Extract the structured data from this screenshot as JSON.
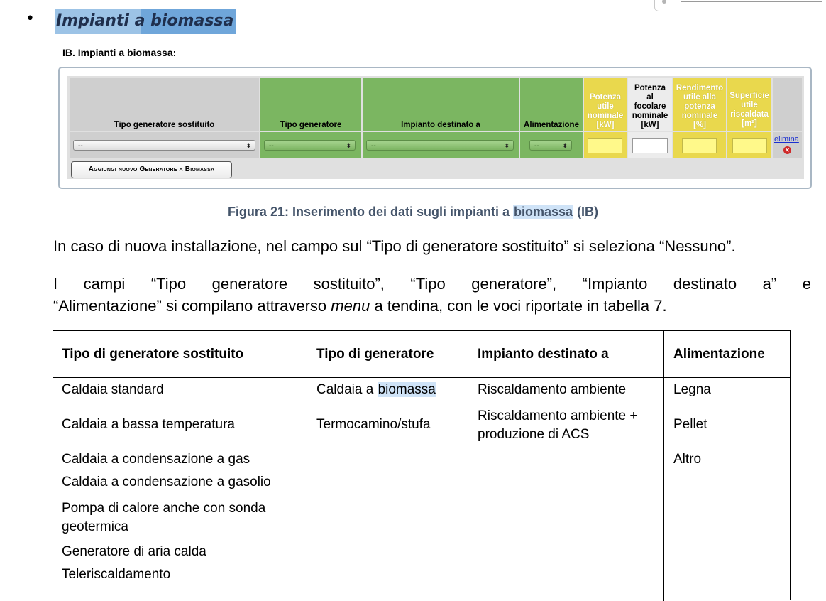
{
  "heading": {
    "bullet": "•",
    "title_part1": "Impianti a ",
    "title_part2": "biomassa"
  },
  "section_title": "IB. Impianti a biomassa:",
  "form": {
    "headers": {
      "tipo_sostituito": "Tipo generatore sostituito",
      "tipo_generatore": "Tipo generatore",
      "impianto_destinato": "Impianto destinato a",
      "alimentazione": "Alimentazione",
      "potenza_utile": [
        "Potenza",
        "utile",
        "nominale",
        "[kW]"
      ],
      "potenza_focolare": [
        "Potenza",
        "al",
        "focolare",
        "nominale",
        "[kW]"
      ],
      "rendimento": [
        "Rendimento",
        "utile alla",
        "potenza",
        "nominale",
        "[%]"
      ],
      "superficie": [
        "Superficie",
        "utile",
        "riscaldata",
        "[m²]"
      ]
    },
    "select_placeholder": "--",
    "delete_link": "elimina",
    "add_button": "Aggiungi nuovo Generatore a Biomassa"
  },
  "caption": {
    "prefix": "Figura 21: Inserimento dei dati sugli impianti a ",
    "highlight": "biomassa",
    "suffix": " (IB)"
  },
  "paragraphs": {
    "p1": "In caso di nuova installazione, nel campo sul “Tipo di generatore sostituito” si seleziona “Nessuno”.",
    "p2": "I campi “Tipo generatore sostituito”, “Tipo generatore”, “Impianto destinato a” e",
    "p3_before": "“Alimentazione” si compilano attraverso ",
    "p3_italic": "menu",
    "p3_after": " a tendina, con le voci riportate in tabella 7."
  },
  "table": {
    "headers": [
      "Tipo di generatore sostituito",
      "Tipo di generatore",
      "Impianto destinato a",
      "Alimentazione"
    ],
    "col1": [
      "Caldaia standard",
      "Caldaia a bassa temperatura",
      "Caldaia a condensazione a gas",
      "Caldaia a condensazione a gasolio",
      "Pompa di calore anche con sonda geotermica",
      "Generatore di aria calda",
      "Teleriscaldamento"
    ],
    "col2": {
      "item1_prefix": "Caldaia a ",
      "item1_highlight": "biomassa",
      "item2": "Termocamino/stufa"
    },
    "col3": [
      "Riscaldamento ambiente",
      "Riscaldamento ambiente + produzione di ACS"
    ],
    "col4": [
      "Legna",
      "Pellet",
      "Altro"
    ]
  }
}
